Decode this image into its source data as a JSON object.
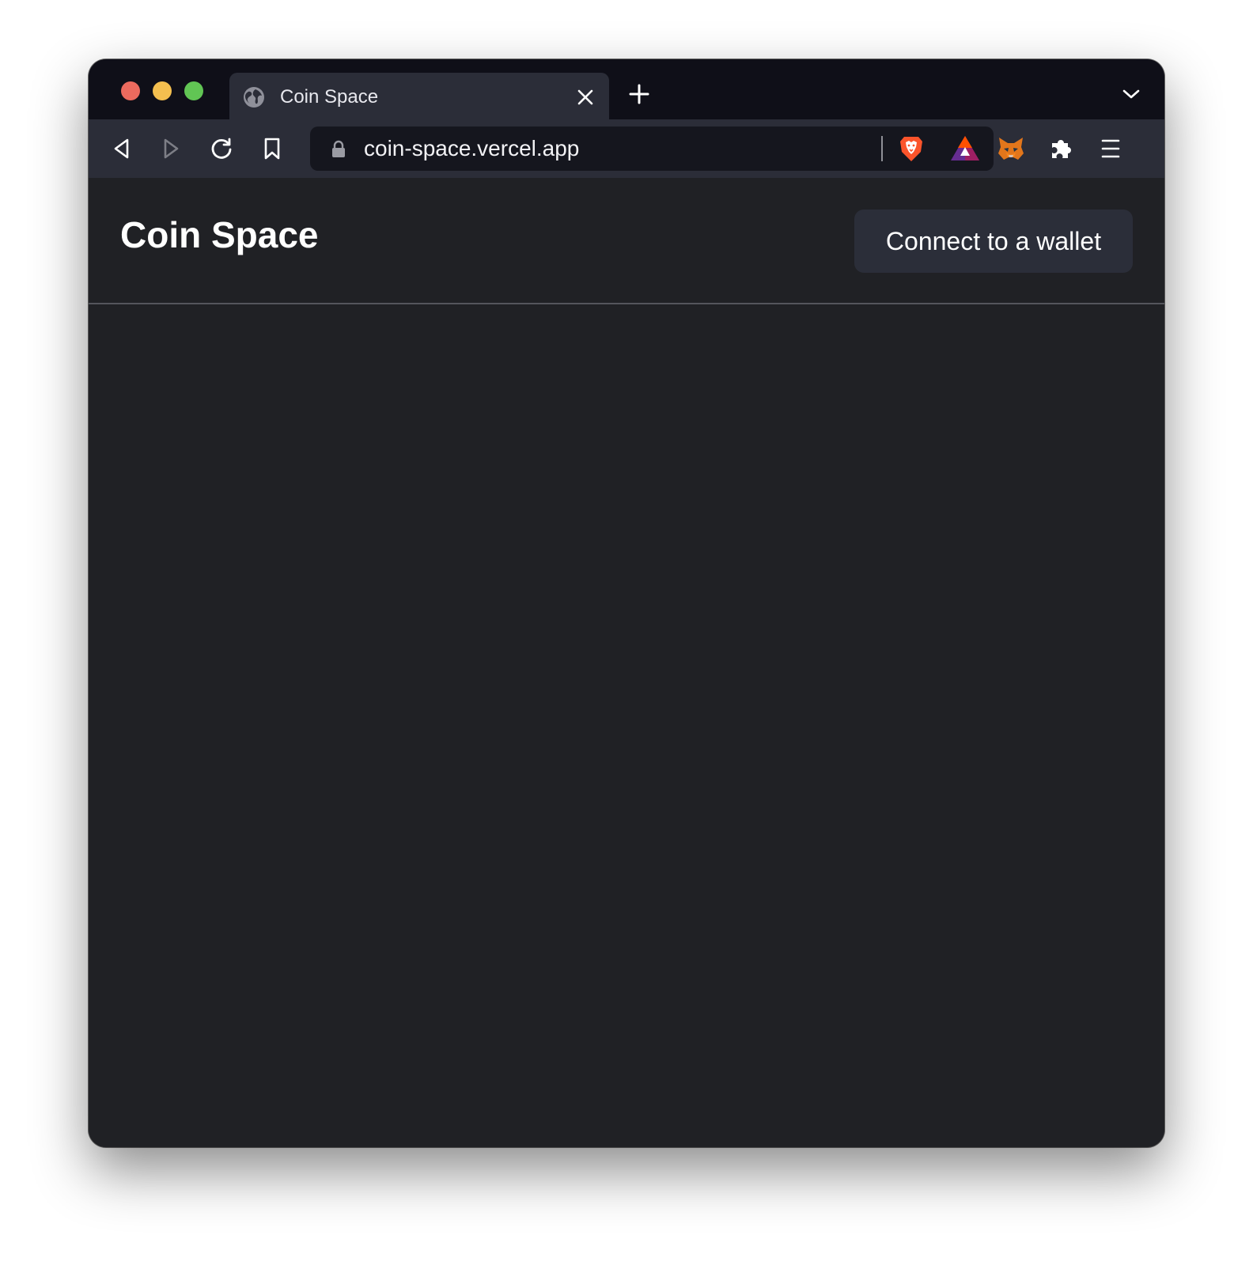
{
  "browser": {
    "tab": {
      "title": "Coin Space"
    },
    "url": "coin-space.vercel.app",
    "icons": {
      "back": "back-arrow-icon",
      "forward": "forward-arrow-icon",
      "reload": "reload-icon",
      "bookmark": "bookmark-icon",
      "lock": "lock-icon",
      "brave_shield": "brave-shield-icon",
      "brave_rewards": "bat-triangle-icon",
      "metamask": "metamask-fox-icon",
      "extensions": "puzzle-icon",
      "menu": "hamburger-menu-icon",
      "new_tab": "plus-icon",
      "tab_close": "close-icon",
      "tab_list": "chevron-down-icon"
    },
    "colors": {
      "tabbar": "#0f0f18",
      "toolbar": "#2b2d38",
      "urlbar": "#15161e"
    }
  },
  "page": {
    "title": "Coin Space",
    "connect_button": "Connect to a wallet",
    "colors": {
      "background": "#202125",
      "button": "#2b2e39",
      "divider": "#54555c"
    }
  }
}
